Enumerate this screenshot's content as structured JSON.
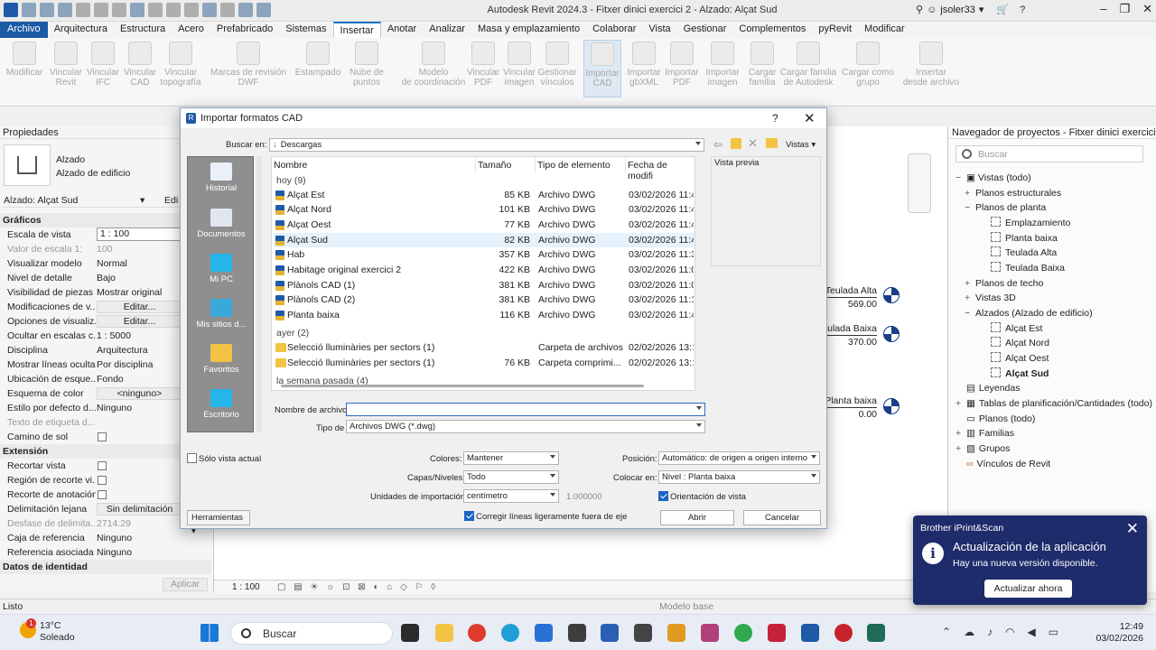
{
  "window": {
    "title": "Autodesk Revit 2024.3 - Fitxer dinici exercici 2 - Alzado: Alçat Sud",
    "user": "jsoler33"
  },
  "menu": {
    "tabs": [
      "Archivo",
      "Arquitectura",
      "Estructura",
      "Acero",
      "Prefabricado",
      "Sistemas",
      "Insertar",
      "Anotar",
      "Analizar",
      "Masa y emplazamiento",
      "Colaborar",
      "Vista",
      "Gestionar",
      "Complementos",
      "pyRevit",
      "Modificar"
    ],
    "active": "Insertar"
  },
  "ribbon": {
    "tools": [
      {
        "l1": "Modificar",
        "l2": ""
      },
      {
        "l1": "Vincular",
        "l2": "Revit"
      },
      {
        "l1": "Vincular",
        "l2": "IFC"
      },
      {
        "l1": "Vincular",
        "l2": "CAD"
      },
      {
        "l1": "Vincular",
        "l2": "topografía"
      },
      {
        "l1": "Marcas de revisión",
        "l2": "DWF"
      },
      {
        "l1": "Estampado",
        "l2": ""
      },
      {
        "l1": "Nube de",
        "l2": "puntos"
      },
      {
        "l1": "Modelo",
        "l2": "de coordinación"
      },
      {
        "l1": "Vincular",
        "l2": "PDF"
      },
      {
        "l1": "Vincular",
        "l2": "imagen"
      },
      {
        "l1": "Gestionar",
        "l2": "vínculos"
      },
      {
        "l1": "Importar",
        "l2": "CAD"
      },
      {
        "l1": "Importar",
        "l2": "gbXML"
      },
      {
        "l1": "Importar",
        "l2": "PDF"
      },
      {
        "l1": "Importar",
        "l2": "imagen"
      },
      {
        "l1": "Cargar",
        "l2": "familia"
      },
      {
        "l1": "Cargar familia",
        "l2": "de Autodesk"
      },
      {
        "l1": "Cargar como",
        "l2": "grupo"
      },
      {
        "l1": "Insertar",
        "l2": "desde archivo"
      }
    ]
  },
  "properties": {
    "title": "Propiedades",
    "family": "Alzado",
    "type": "Alzado de edificio",
    "selector": "Alzado: Alçat Sud",
    "edit": "Edi",
    "section_graphics": "Gráficos",
    "rows": [
      {
        "k": "Escala de vista",
        "v": "1 : 100"
      },
      {
        "k": "Valor de escala    1:",
        "v": "100"
      },
      {
        "k": "Visualizar modelo",
        "v": "Normal"
      },
      {
        "k": "Nivel de detalle",
        "v": "Bajo"
      },
      {
        "k": "Visibilidad de piezas",
        "v": "Mostrar original"
      },
      {
        "k": "Modificaciones de v...",
        "v": "Editar..."
      },
      {
        "k": "Opciones de visualiz...",
        "v": "Editar..."
      },
      {
        "k": "Ocultar en escalas c...",
        "v": "1 : 5000"
      },
      {
        "k": "Disciplina",
        "v": "Arquitectura"
      },
      {
        "k": "Mostrar líneas ocultas",
        "v": "Por disciplina"
      },
      {
        "k": "Ubicación de esque...",
        "v": "Fondo"
      },
      {
        "k": "Esquema de color",
        "v": "<ninguno>"
      },
      {
        "k": "Estilo por defecto d...",
        "v": "Ninguno"
      },
      {
        "k": "Texto de etiqueta d...",
        "v": ""
      },
      {
        "k": "Camino de sol",
        "v": ""
      }
    ],
    "section_extents": "Extensión",
    "rows2": [
      {
        "k": "Recortar vista",
        "v": ""
      },
      {
        "k": "Región de recorte vi...",
        "v": ""
      },
      {
        "k": "Recorte de anotación",
        "v": ""
      },
      {
        "k": "Delimitación lejana",
        "v": "Sin delimitación"
      },
      {
        "k": "Desfase de delimita...",
        "v": "2714.29"
      },
      {
        "k": "Caja de referencia",
        "v": "Ninguno"
      },
      {
        "k": "Referencia asociada",
        "v": "Ninguno"
      }
    ],
    "section_identity": "Datos de identidad",
    "apply": "Aplicar"
  },
  "canvas": {
    "levels": [
      {
        "name": "Teulada Alta",
        "value": "569.00"
      },
      {
        "name": "Teulada Baixa",
        "value": "370.00"
      },
      {
        "name": "Planta baixa",
        "value": "0.00"
      }
    ],
    "scale": "1 : 100",
    "model_base": "Modelo base"
  },
  "status": {
    "ready": "Listo"
  },
  "browser": {
    "title": "Navegador de proyectos - Fitxer dinici exercici 2",
    "search_placeholder": "Buscar",
    "views_all": "Vistas (todo)",
    "structural_plans": "Planos estructurales",
    "floor_plans": "Planos de planta",
    "fp_items": [
      "Emplazamiento",
      "Planta baixa",
      "Teulada Alta",
      "Teulada Baixa"
    ],
    "ceiling_plans": "Planos de techo",
    "views_3d": "Vistas 3D",
    "elevations": "Alzados (Alzado de edificio)",
    "el_items": [
      "Alçat Est",
      "Alçat Nord",
      "Alçat Oest",
      "Alçat Sud"
    ],
    "legends": "Leyendas",
    "schedules": "Tablas de planificación/Cantidades (todo)",
    "sheets": "Planos (todo)",
    "families": "Familias",
    "groups": "Grupos",
    "links": "Vínculos de Revit"
  },
  "dialog": {
    "title": "Importar formatos CAD",
    "help": "?",
    "look_in_label": "Buscar en:",
    "look_in": "Descargas",
    "views_btn": "Vistas",
    "places": [
      "Historial",
      "Documentos",
      "Mi PC",
      "Mis sitios d...",
      "Favoritos",
      "Escritorio"
    ],
    "columns": [
      "Nombre",
      "Tamaño",
      "Tipo de elemento",
      "Fecha de modifi"
    ],
    "group_today": "hoy (9)",
    "files_today": [
      {
        "name": "Alçat Est",
        "size": "85 KB",
        "type": "Archivo DWG",
        "date": "03/02/2026 11:4"
      },
      {
        "name": "Alçat Nord",
        "size": "101 KB",
        "type": "Archivo DWG",
        "date": "03/02/2026 11:4"
      },
      {
        "name": "Alçat Oest",
        "size": "77 KB",
        "type": "Archivo DWG",
        "date": "03/02/2026 11:4"
      },
      {
        "name": "Alçat Sud",
        "size": "82 KB",
        "type": "Archivo DWG",
        "date": "03/02/2026 11:4"
      },
      {
        "name": "Hab",
        "size": "357 KB",
        "type": "Archivo DWG",
        "date": "03/02/2026 11:3"
      },
      {
        "name": "Habitage original exercici 2",
        "size": "422 KB",
        "type": "Archivo DWG",
        "date": "03/02/2026 11:0"
      },
      {
        "name": "Plànols CAD (1)",
        "size": "381 KB",
        "type": "Archivo DWG",
        "date": "03/02/2026 11:0"
      },
      {
        "name": "Plànols CAD (2)",
        "size": "381 KB",
        "type": "Archivo DWG",
        "date": "03/02/2026 11:1"
      },
      {
        "name": "Planta baixa",
        "size": "116 KB",
        "type": "Archivo DWG",
        "date": "03/02/2026 11:4"
      }
    ],
    "group_yesterday": "ayer (2)",
    "files_yesterday": [
      {
        "name": "Selecció lluminàries per sectors (1)",
        "size": "",
        "type": "Carpeta de archivos",
        "date": "02/02/2026 13:1"
      },
      {
        "name": "Selecció lluminàries per sectors (1)",
        "size": "76 KB",
        "type": "Carpeta comprimi...",
        "date": "02/02/2026 13:1"
      }
    ],
    "group_lastweek": "la semana pasada (4)",
    "preview_label": "Vista previa",
    "filename_label": "Nombre de archivo:",
    "filename": "",
    "filetype_label": "Tipo de",
    "filetype": "Archivos DWG  (*.dwg)",
    "current_view_only": "Sólo vista actual",
    "colors_label": "Colores:",
    "colors": "Mantener",
    "layers_label": "Capas/Niveles:",
    "layers": "Todo",
    "units_label": "Unidades de importación:",
    "units": "centímetro",
    "units_factor": "1.000000",
    "correct_lines": "Corregir líneas ligeramente fuera de eje",
    "position_label": "Posición:",
    "position": "Automático: de origen a origen interno",
    "place_at_label": "Colocar en:",
    "place_at": "Nivel : Planta baixa",
    "orient_to_view": "Orientación de vista",
    "tools": "Herramientas",
    "open": "Abrir",
    "cancel": "Cancelar"
  },
  "toast": {
    "app": "Brother iPrint&Scan",
    "title": "Actualización de la aplicación",
    "body": "Hay una nueva versión disponible.",
    "button": "Actualizar ahora"
  },
  "taskbar": {
    "temp": "13°C",
    "weather": "Soleado",
    "weather_badge": "1",
    "search": "Buscar",
    "time": "12:49",
    "date": "03/02/2026"
  }
}
